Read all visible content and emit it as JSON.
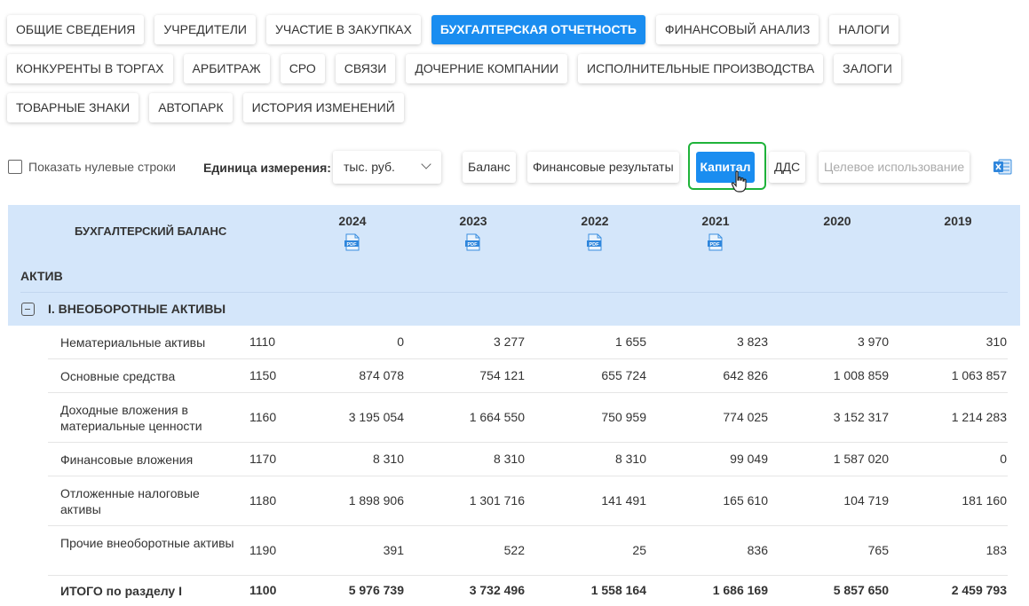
{
  "tabs": [
    [
      {
        "label": "ОБЩИЕ СВЕДЕНИЯ",
        "active": false
      },
      {
        "label": "УЧРЕДИТЕЛИ",
        "active": false
      },
      {
        "label": "УЧАСТИЕ В ЗАКУПКАХ",
        "active": false
      },
      {
        "label": "БУХГАЛТЕРСКАЯ ОТЧЕТНОСТЬ",
        "active": true
      },
      {
        "label": "ФИНАНСОВЫЙ АНАЛИЗ",
        "active": false
      },
      {
        "label": "НАЛОГИ",
        "active": false
      }
    ],
    [
      {
        "label": "КОНКУРЕНТЫ В ТОРГАХ",
        "active": false
      },
      {
        "label": "АРБИТРАЖ",
        "active": false
      },
      {
        "label": "СРО",
        "active": false
      },
      {
        "label": "СВЯЗИ",
        "active": false
      },
      {
        "label": "ДОЧЕРНИЕ КОМПАНИИ",
        "active": false
      },
      {
        "label": "ИСПОЛНИТЕЛЬНЫЕ ПРОИЗВОДСТВА",
        "active": false
      },
      {
        "label": "ЗАЛОГИ",
        "active": false
      }
    ],
    [
      {
        "label": "ТОВАРНЫЕ ЗНАКИ",
        "active": false
      },
      {
        "label": "АВТОПАРК",
        "active": false
      },
      {
        "label": "ИСТОРИЯ ИЗМЕНЕНИЙ",
        "active": false
      }
    ]
  ],
  "filters": {
    "show_zero_label": "Показать нулевые строки",
    "show_zero_checked": false,
    "unit_label": "Единица измерения:",
    "unit_value": "тыс. руб.",
    "buttons": {
      "balance": "Баланс",
      "fin_results": "Финансовые результаты",
      "capital": "Капитал",
      "dds": "ДДС",
      "target_use": "Целевое использование"
    },
    "excel_icon": "excel-export-icon"
  },
  "table": {
    "title": "БУХГАЛТЕРСКИЙ БАЛАНС",
    "years": [
      {
        "year": "2024",
        "pdf": true
      },
      {
        "year": "2023",
        "pdf": true
      },
      {
        "year": "2022",
        "pdf": true
      },
      {
        "year": "2021",
        "pdf": true
      },
      {
        "year": "2020",
        "pdf": false
      },
      {
        "year": "2019",
        "pdf": false
      }
    ],
    "pdf_label": "PDF",
    "group_label": "АКТИВ",
    "section_title": "I. ВНЕОБОРОТНЫЕ АКТИВЫ",
    "rows": [
      {
        "name": "Нематериальные активы",
        "code": "1110",
        "values": [
          "0",
          "3 277",
          "1 655",
          "3 823",
          "3 970",
          "310"
        ],
        "total": false
      },
      {
        "name": "Основные средства",
        "code": "1150",
        "values": [
          "874 078",
          "754 121",
          "655 724",
          "642 826",
          "1 008 859",
          "1 063 857"
        ],
        "total": false
      },
      {
        "name": "Доходные вложения в материальные ценности",
        "code": "1160",
        "values": [
          "3 195 054",
          "1 664 550",
          "750 959",
          "774 025",
          "3 152 317",
          "1 214 283"
        ],
        "total": false
      },
      {
        "name": "Финансовые вложения",
        "code": "1170",
        "values": [
          "8 310",
          "8 310",
          "8 310",
          "99 049",
          "1 587 020",
          "0"
        ],
        "total": false
      },
      {
        "name": "Отложенные налоговые активы",
        "code": "1180",
        "values": [
          "1 898 906",
          "1 301 716",
          "141 491",
          "165 610",
          "104 719",
          "181 160"
        ],
        "total": false
      },
      {
        "name": "Прочие внеоборотные активы",
        "code": "1190",
        "values": [
          "391",
          "522",
          "25",
          "836",
          "765",
          "183"
        ],
        "total": false
      },
      {
        "name": "ИТОГО по разделу I",
        "code": "1100",
        "values": [
          "5 976 739",
          "3 732 496",
          "1 558 164",
          "1 686 169",
          "5 857 650",
          "2 459 793"
        ],
        "total": true
      }
    ]
  }
}
